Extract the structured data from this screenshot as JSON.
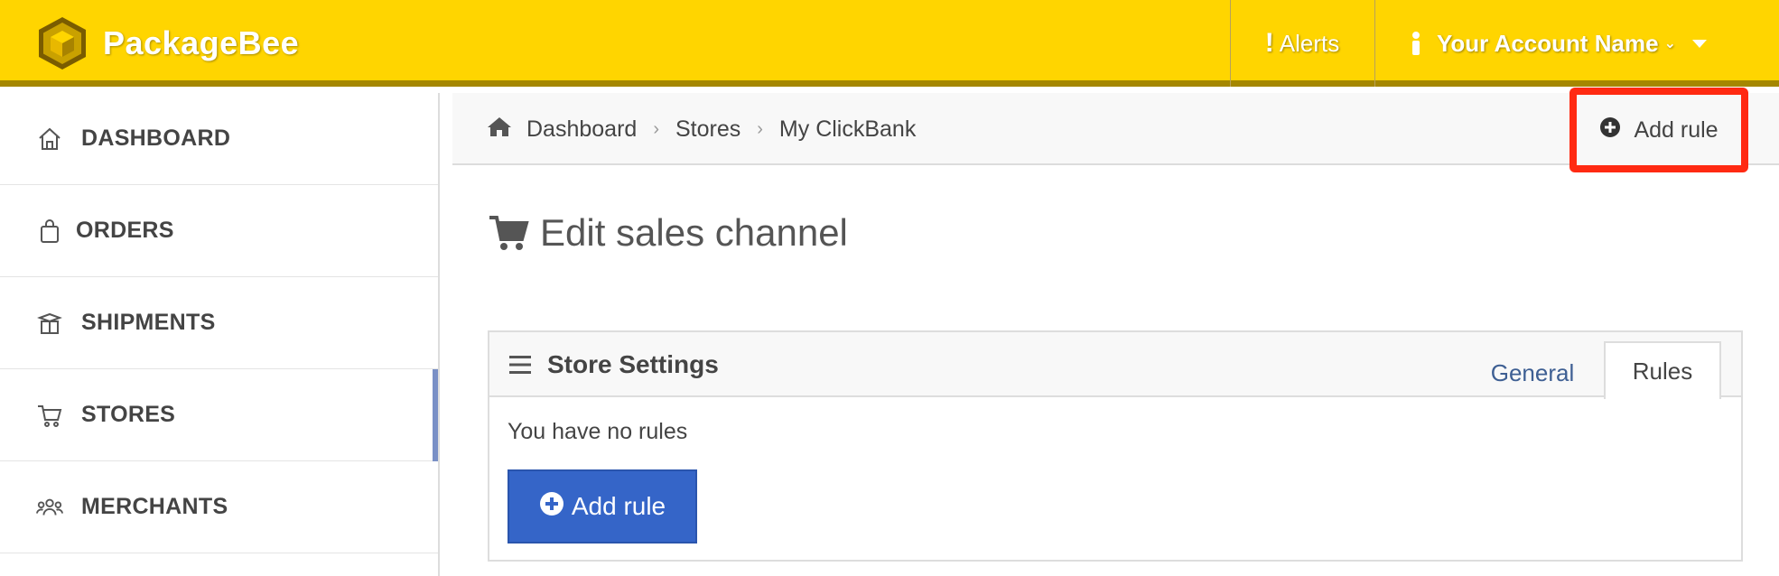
{
  "app": {
    "name": "PackageBee"
  },
  "topbar": {
    "alerts_label": "Alerts",
    "account_label": "Your Account Name",
    "brand_color": "#ffd500"
  },
  "sidebar": {
    "items": [
      {
        "label": "DASHBOARD",
        "icon": "home-icon",
        "active": false
      },
      {
        "label": "ORDERS",
        "icon": "shopping-bag-icon",
        "active": false
      },
      {
        "label": "SHIPMENTS",
        "icon": "package-icon",
        "active": false
      },
      {
        "label": "STORES",
        "icon": "cart-icon",
        "active": true
      },
      {
        "label": "MERCHANTS",
        "icon": "users-icon",
        "active": false
      }
    ]
  },
  "breadcrumb": {
    "items": [
      "Dashboard",
      "Stores",
      "My ClickBank"
    ],
    "action_label": "Add rule"
  },
  "page": {
    "title": "Edit sales channel"
  },
  "panel": {
    "title": "Store Settings",
    "tabs": [
      {
        "label": "General",
        "active": false
      },
      {
        "label": "Rules",
        "active": true
      }
    ],
    "empty_text": "You have no rules",
    "add_button_label": "Add rule",
    "button_color": "#3565c8"
  },
  "highlight_color": "#ff2a12"
}
